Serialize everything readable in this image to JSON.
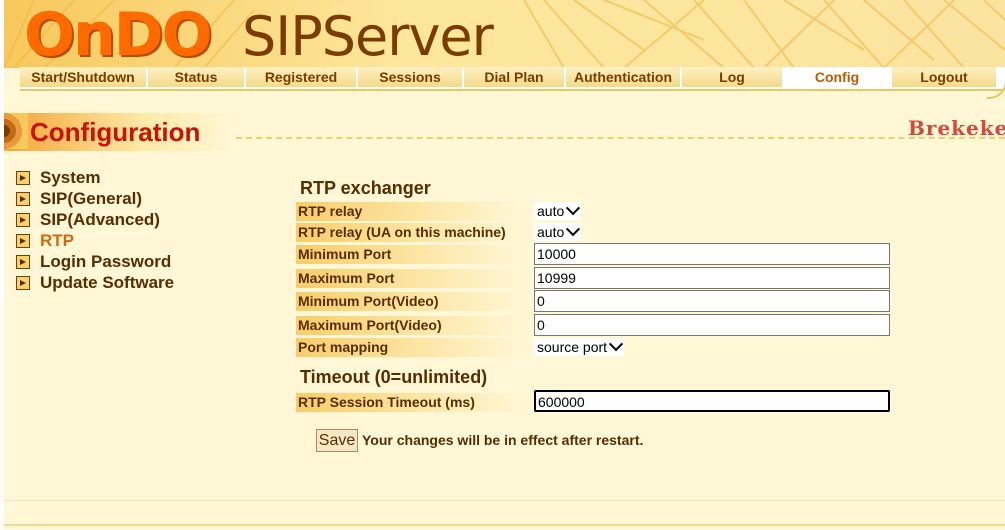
{
  "header": {
    "logo_left": "OnDO",
    "logo_right": "SIPServer"
  },
  "nav": {
    "items": [
      {
        "label": "Start/Shutdown"
      },
      {
        "label": "Status"
      },
      {
        "label": "Registered"
      },
      {
        "label": "Sessions"
      },
      {
        "label": "Dial Plan"
      },
      {
        "label": "Authentication"
      },
      {
        "label": "Log"
      },
      {
        "label": "Config"
      },
      {
        "label": "Logout"
      }
    ],
    "active": "Config"
  },
  "page": {
    "title": "Configuration",
    "brand": "Brekeke"
  },
  "menu": {
    "items": [
      {
        "label": "System"
      },
      {
        "label": "SIP(General)"
      },
      {
        "label": "SIP(Advanced)"
      },
      {
        "label": "RTP"
      },
      {
        "label": "Login Password"
      },
      {
        "label": "Update Software"
      }
    ],
    "active": "RTP"
  },
  "rtp": {
    "section_title": "RTP exchanger",
    "rtp_relay": {
      "label": "RTP relay",
      "value": "auto"
    },
    "rtp_relay_ua": {
      "label": "RTP relay (UA on this machine)",
      "value": "auto"
    },
    "min_port": {
      "label": "Minimum Port",
      "value": "10000"
    },
    "max_port": {
      "label": "Maximum Port",
      "value": "10999"
    },
    "min_port_video": {
      "label": "Minimum Port(Video)",
      "value": "0"
    },
    "max_port_video": {
      "label": "Maximum Port(Video)",
      "value": "0"
    },
    "port_mapping": {
      "label": "Port mapping",
      "value": "source port"
    }
  },
  "timeout": {
    "section_title": "Timeout (0=unlimited)",
    "session_timeout": {
      "label": "RTP Session Timeout (ms)",
      "value": "600000"
    }
  },
  "footer": {
    "save_label": "Save",
    "note": "Your changes will be in effect after restart."
  },
  "colors": {
    "accent": "#ff6a00",
    "title": "#cc1100",
    "text": "#5a2d00",
    "background": "#fff7d6"
  }
}
